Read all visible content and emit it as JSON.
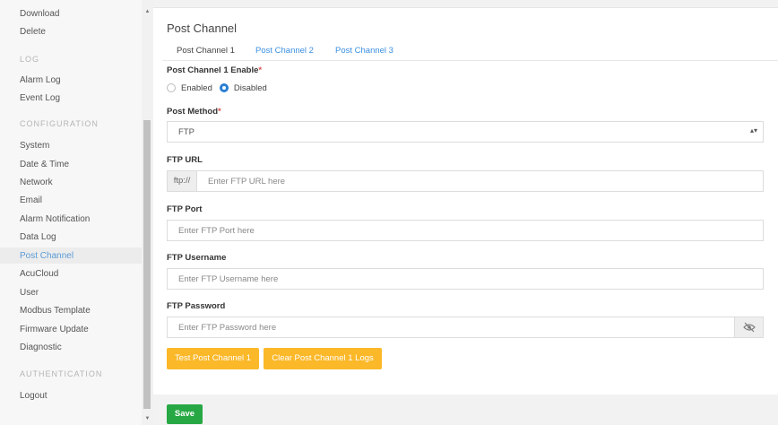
{
  "sidebar": {
    "items_top": [
      "Download",
      "Delete"
    ],
    "log_header": "LOG",
    "log_items": [
      "Alarm Log",
      "Event Log"
    ],
    "config_header": "CONFIGURATION",
    "config_items": [
      "System",
      "Date & Time",
      "Network",
      "Email",
      "Alarm Notification",
      "Data Log",
      "Post Channel",
      "AcuCloud",
      "User",
      "Modbus Template",
      "Firmware Update",
      "Diagnostic"
    ],
    "auth_header": "AUTHENTICATION",
    "auth_items": [
      "Logout"
    ],
    "active_item": "Post Channel"
  },
  "main": {
    "title": "Post Channel",
    "tabs": [
      "Post Channel 1",
      "Post Channel 2",
      "Post Channel 3"
    ],
    "active_tab": "Post Channel 1",
    "enable": {
      "label": "Post Channel 1 Enable",
      "required_mark": "*",
      "options": [
        "Enabled",
        "Disabled"
      ],
      "selected": "Disabled"
    },
    "post_method": {
      "label": "Post Method",
      "required_mark": "*",
      "value": "FTP"
    },
    "ftp_url": {
      "label": "FTP URL",
      "prefix": "ftp://",
      "placeholder": "Enter FTP URL here"
    },
    "ftp_port": {
      "label": "FTP Port",
      "placeholder": "Enter FTP Port here"
    },
    "ftp_username": {
      "label": "FTP Username",
      "placeholder": "Enter FTP Username here"
    },
    "ftp_password": {
      "label": "FTP Password",
      "placeholder": "Enter FTP Password here",
      "toggle_icon": "eye-slash-icon"
    },
    "buttons": {
      "test": "Test Post Channel 1",
      "clear": "Clear Post Channel 1 Logs",
      "save": "Save"
    }
  },
  "colors": {
    "accent_blue": "#3b8fe0",
    "button_yellow": "#fbb829",
    "button_green": "#27a845",
    "required_red": "#d9534f"
  }
}
